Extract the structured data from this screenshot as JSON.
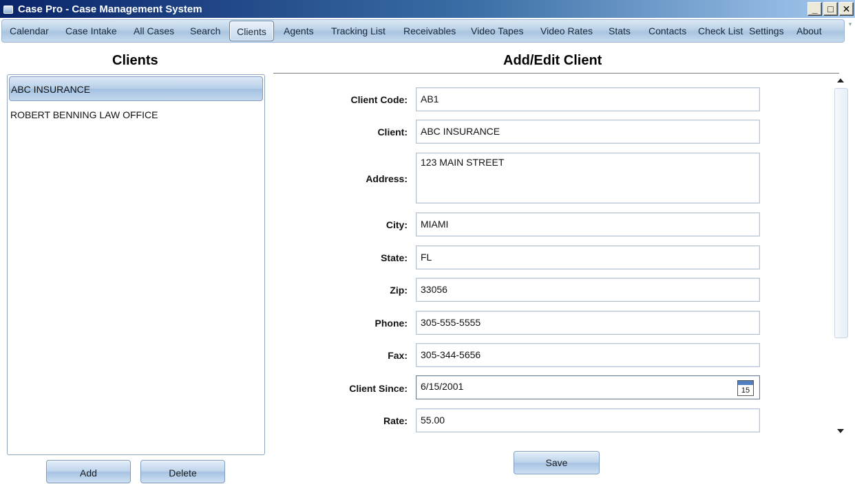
{
  "window": {
    "title": "Case Pro - Case Management System",
    "minimize": "_",
    "maximize": "□",
    "close": "✕"
  },
  "menu": {
    "items": [
      {
        "label": "Calendar"
      },
      {
        "label": "Case Intake"
      },
      {
        "label": "All Cases"
      },
      {
        "label": "Search"
      },
      {
        "label": "Clients"
      },
      {
        "label": "Agents"
      },
      {
        "label": "Tracking List"
      },
      {
        "label": "Receivables"
      },
      {
        "label": "Video Tapes"
      },
      {
        "label": "Video Rates"
      },
      {
        "label": "Stats"
      },
      {
        "label": "Contacts"
      },
      {
        "label": "Check List"
      },
      {
        "label": "Settings"
      },
      {
        "label": "About"
      }
    ],
    "active": "Clients"
  },
  "clients_panel": {
    "title": "Clients",
    "items": [
      "ABC INSURANCE",
      "ROBERT BENNING LAW OFFICE"
    ],
    "selected": "ABC INSURANCE",
    "add_label": "Add",
    "delete_label": "Delete"
  },
  "form": {
    "title": "Add/Edit Client",
    "fields": {
      "client_code": {
        "label": "Client Code:",
        "value": "AB1"
      },
      "client": {
        "label": "Client:",
        "value": "ABC INSURANCE"
      },
      "address": {
        "label": "Address:",
        "value": "123 MAIN STREET"
      },
      "city": {
        "label": "City:",
        "value": "MIAMI"
      },
      "state": {
        "label": "State:",
        "value": "FL"
      },
      "zip": {
        "label": "Zip:",
        "value": "33056"
      },
      "phone": {
        "label": "Phone:",
        "value": "305-555-5555"
      },
      "fax": {
        "label": "Fax:",
        "value": "305-344-5656"
      },
      "client_since": {
        "label": "Client Since:",
        "value": "6/15/2001",
        "calendar_day": "15"
      },
      "rate": {
        "label": "Rate:",
        "value": "55.00"
      }
    },
    "save_label": "Save"
  },
  "icons": {
    "app": "app-icon",
    "calendar": "calendar-icon"
  },
  "colors": {
    "titlebar_start": "#0a246a",
    "titlebar_end": "#a6caf0",
    "accent": "#b9d0e7"
  }
}
